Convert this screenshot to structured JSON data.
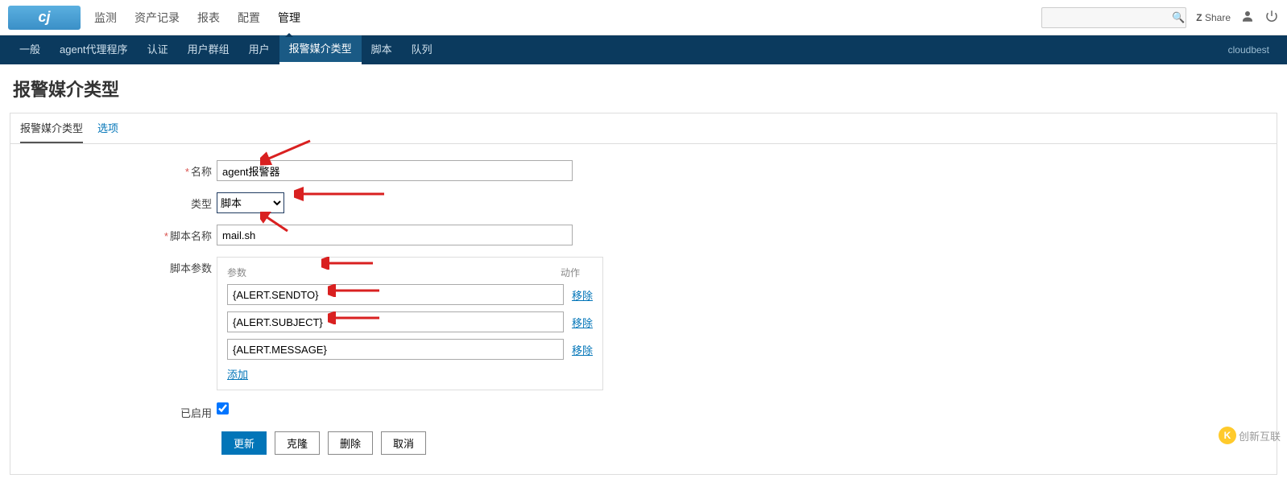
{
  "topnav": {
    "items": [
      "监测",
      "资产记录",
      "报表",
      "配置",
      "管理"
    ],
    "active_index": 4,
    "share_label": "Share",
    "search_placeholder": ""
  },
  "subnav": {
    "items": [
      "一般",
      "agent代理程序",
      "认证",
      "用户群组",
      "用户",
      "报警媒介类型",
      "脚本",
      "队列"
    ],
    "active_index": 5,
    "tenant": "cloudbest"
  },
  "page": {
    "title": "报警媒介类型"
  },
  "tabs": {
    "main": "报警媒介类型",
    "options": "选项"
  },
  "form": {
    "labels": {
      "name": "名称",
      "type": "类型",
      "script_name": "脚本名称",
      "script_params": "脚本参数",
      "enabled": "已启用"
    },
    "values": {
      "name": "agent报警器",
      "type": "脚本",
      "script_name": "mail.sh",
      "enabled": true
    },
    "params_header": {
      "param": "参数",
      "action": "动作"
    },
    "params": [
      {
        "value": "{ALERT.SENDTO}"
      },
      {
        "value": "{ALERT.SUBJECT}"
      },
      {
        "value": "{ALERT.MESSAGE}"
      }
    ],
    "links": {
      "remove": "移除",
      "add": "添加"
    },
    "buttons": {
      "update": "更新",
      "clone": "克隆",
      "delete": "删除",
      "cancel": "取消"
    }
  },
  "watermark": {
    "text": "创新互联"
  }
}
